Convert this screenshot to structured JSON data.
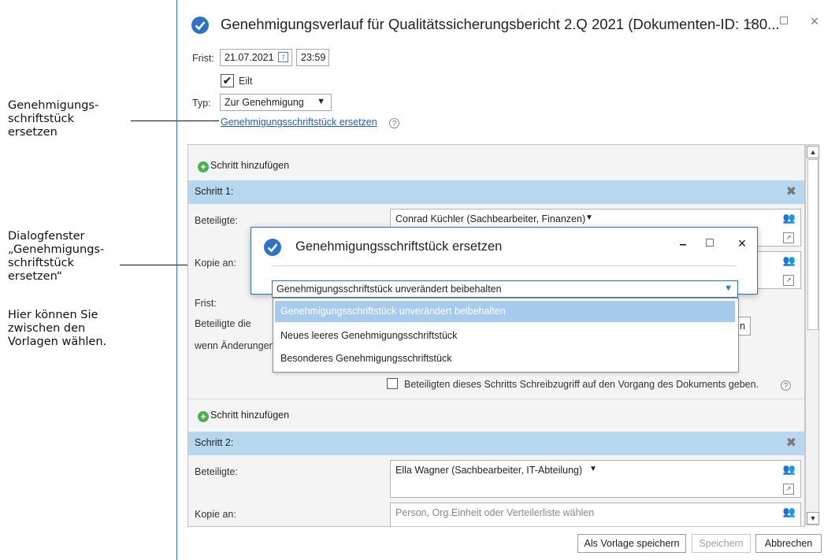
{
  "annotations": {
    "a1": "Genehmigungs-\nschriftstück\nersetzen",
    "a2": "Dialogfenster\n„Genehmigungs-\nschriftstück\nersetzen“",
    "a3": "Hier können Sie\nzwischen den\nVorlagen wählen."
  },
  "window": {
    "title": "Genehmigungsverlauf für Qualitätssicherungsbericht 2.Q 2021 (Dokumenten-ID: 180...",
    "min": "–",
    "max": "□",
    "close": "×"
  },
  "form": {
    "frist_label": "Frist:",
    "date": "21.07.2021",
    "time": "23:59",
    "eilt_label": "Eilt",
    "typ_label": "Typ:",
    "typ_value": "Zur Genehmigung",
    "replace_link": "Genehmigungsschriftstück ersetzen",
    "help": "?"
  },
  "steps": {
    "add_step": "Schritt hinzufügen",
    "step1": {
      "header": "Schritt 1:",
      "beteiligte_label": "Beteiligte:",
      "beteiligte_value": "Conrad Küchler (Sachbearbeiter, Finanzen)",
      "kopie_label": "Kopie an:",
      "frist_label": "Frist:",
      "beteiligte_die": "Beteiligte die",
      "wenn_aenderungen": "wenn Änderungen",
      "hidden_btn_tail": "n",
      "checkbox_label": "Beteiligten dieses Schritts Schreibzugriff auf den Vorgang des Dokuments geben."
    },
    "step2": {
      "header": "Schritt 2:",
      "beteiligte_label": "Beteiligte:",
      "beteiligte_value": "Ella Wagner (Sachbearbeiter, IT-Abteilung)",
      "kopie_label": "Kopie an:",
      "kopie_placeholder": "Person, Org.Einheit oder Verteilerliste wählen"
    }
  },
  "buttons": {
    "save_template": "Als Vorlage speichern",
    "save": "Speichern",
    "cancel": "Abbrechen"
  },
  "dialog": {
    "title": "Genehmigungsschriftstück ersetzen",
    "min": "–",
    "max": "□",
    "close": "×",
    "select_value": "Genehmigungsschriftstück unverändert beibehalten",
    "options": [
      "Genehmigungsschriftstück unverändert beibehalten",
      "Neues leeres Genehmigungsschriftstück",
      "Besonderes Genehmigungsschriftstück"
    ]
  },
  "colors": {
    "accent": "#2b73c7",
    "step_header": "#b7d7ef",
    "selected_option": "#a7cbee"
  }
}
